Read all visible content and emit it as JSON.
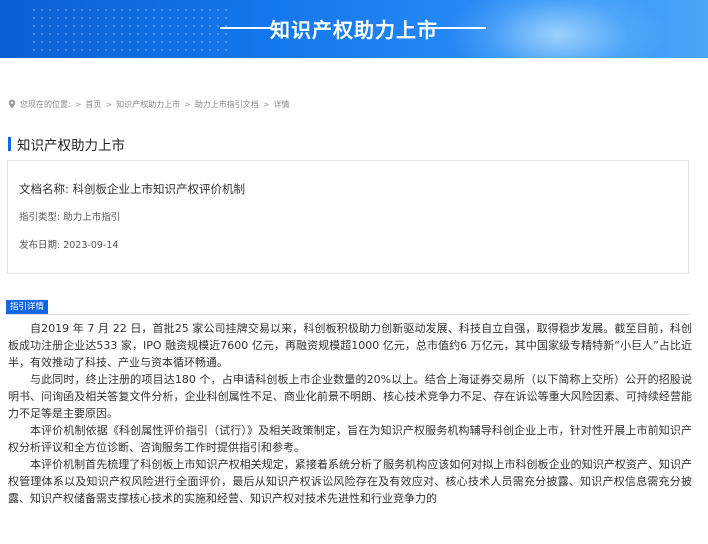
{
  "banner": {
    "title": "知识产权助力上市"
  },
  "breadcrumb": {
    "label": "您现在的位置:",
    "items": [
      "首页",
      "知识产权助力上市",
      "助力上市指引文档",
      "详情"
    ],
    "separator": ">"
  },
  "section": {
    "title": "知识产权助力上市"
  },
  "document": {
    "name": "文档名称: 科创板企业上市知识产权评价机制",
    "type": "指引类型: 助力上市指引",
    "date": "发布日期: 2023-09-14"
  },
  "detail_tab": {
    "label": "指引详情"
  },
  "content": {
    "paragraphs": [
      "自2019 年 7 月 22 日，首批25 家公司挂牌交易以来，科创板积极助力创新驱动发展、科技自立自强，取得稳步发展。截至目前，科创板成功注册企业达533 家，IPO 融资规模近7600 亿元，再融资规模超1000 亿元，总市值约6 万亿元，其中国家级专精特新“小巨人”占比近半，有效推动了科技、产业与资本循环畅通。",
      "与此同时，终止注册的项目达180 个，占申请科创板上市企业数量的20%以上。结合上海证券交易所（以下简称上交所）公开的招股说明书、问询函及相关答复文件分析，企业科创属性不足、商业化前景不明朗、核心技术竞争力不足、存在诉讼等重大风险因素、可持续经营能力不足等是主要原因。",
      "本评价机制依据《科创属性评价指引（试行）》及相关政策制定，旨在为知识产权服务机构辅导科创企业上市，针对性开展上市前知识产权分析评议和全方位诊断、咨询服务工作时提供指引和参考。",
      "本评价机制首先梳理了科创板上市知识产权相关规定，紧接着系统分析了服务机构应该如何对拟上市科创板企业的知识产权资产、知识产权管理体系以及知识产权风险进行全面评价，最后从知识产权诉讼风险存在及有效应对、核心技术人员需充分披露、知识产权信息需充分披露、知识产权储备需支撑核心技术的实施和经营、知识产权对技术先进性和行业竞争力的"
    ]
  },
  "colors": {
    "accent": "#1268e4",
    "banner_start": "#0b5fd4",
    "banner_end": "#4aa6f8"
  }
}
